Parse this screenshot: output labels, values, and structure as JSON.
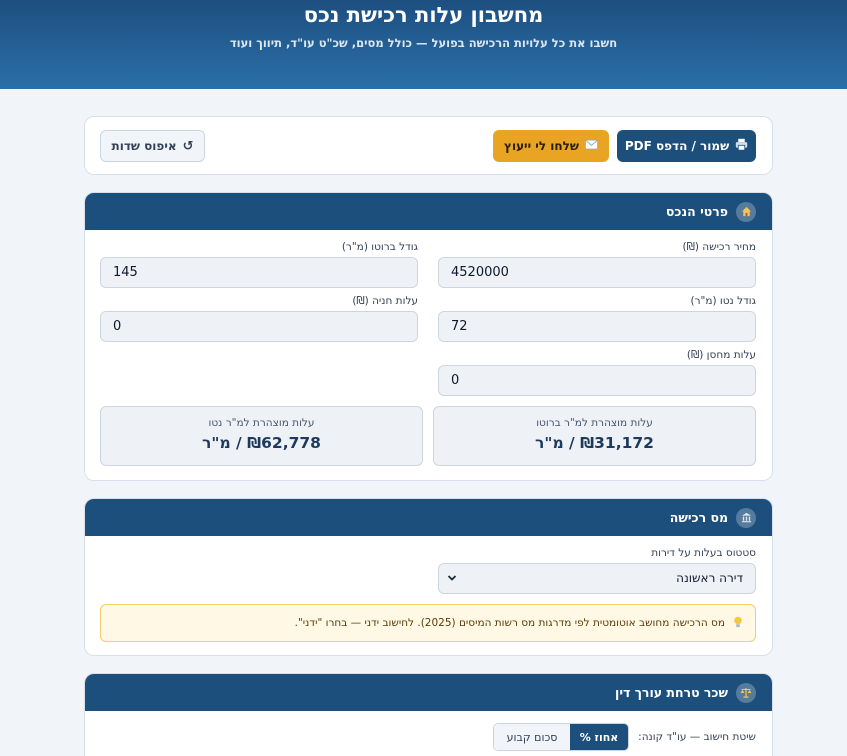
{
  "header": {
    "title": "מחשבון עלות רכישת נכס",
    "subtitle": "חשבו את כל עלויות הרכישה בפועל — כולל מסים, שכ\"ט עו\"ד, תיווך ועוד"
  },
  "toolbar": {
    "pdf_label": "שמור / הדפס PDF",
    "advisor_label": "שלחו לי ייעוץ",
    "reset_label": "איפוס שדות"
  },
  "property": {
    "title": "פרטי הנכס",
    "fields": {
      "purchase_price": {
        "label": "מחיר רכישה (₪)",
        "value": "4520000"
      },
      "gross_size": {
        "label": "גודל ברוטו (מ\"ר)",
        "value": "145"
      },
      "net_size": {
        "label": "גודל נטו (מ\"ר)",
        "value": "72"
      },
      "parking_cost": {
        "label": "עלות חניה (₪)",
        "value": "0"
      },
      "storage_cost": {
        "label": "עלות מחסן (₪)",
        "value": "0"
      }
    },
    "stats": {
      "gross": {
        "label": "עלות מוצהרת למ\"ר ברוטו",
        "value": "₪31,172 / מ\"ר"
      },
      "net": {
        "label": "עלות מוצהרת למ\"ר נטו",
        "value": "₪62,778 / מ\"ר"
      }
    }
  },
  "tax": {
    "title": "מס רכישה",
    "status_label": "סטטוס בעלות על דירות",
    "status_value": "דירה ראשונה",
    "notice": "מס הרכישה מחושב אוטומטית לפי מדרגות מס רשות המיסים (2025). לחישוב ידני — בחרו \"ידני\"."
  },
  "lawyer": {
    "title": "שכר טרחת עורך דין",
    "method_label": "שיטת חישוב — עו\"ד קונה:",
    "option_percent": "אחוז %",
    "option_fixed": "סכום קבוע"
  },
  "icons": {
    "pdf": "printer-icon",
    "advisor": "envelope-icon",
    "reset": "refresh-icon",
    "property": "house-icon",
    "tax": "bank-icon",
    "lawyer": "scales-icon",
    "notice": "lightbulb-icon"
  },
  "colors": {
    "primary": "#1d4f7c",
    "accent": "#e8a422",
    "notice_bg": "#fef8e4"
  }
}
